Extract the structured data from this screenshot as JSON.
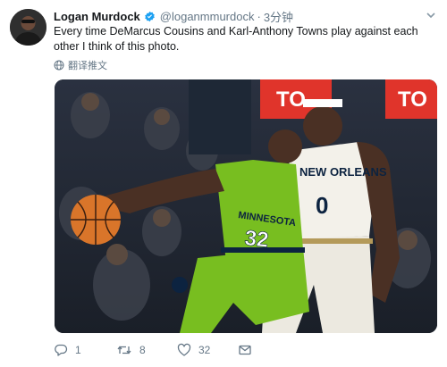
{
  "tweet": {
    "author_name": "Logan Murdock",
    "handle": "@loganmmurdock",
    "separator": "·",
    "time": "3分钟",
    "text": "Every time DeMarcus Cousins and Karl-Anthony Towns play against each other I think of this photo.",
    "translate_label": "翻译推文"
  },
  "photo": {
    "banner_left": "TO",
    "banner_right": "TO",
    "jersey_green_team": "MINNESOTA",
    "jersey_green_number": "32",
    "jersey_white_team": "NEW ORLEANS",
    "jersey_white_number": "0"
  },
  "actions": {
    "reply_count": "1",
    "retweet_count": "8",
    "like_count": "32"
  },
  "colors": {
    "verified": "#1da1f2",
    "icon_gray": "#657786",
    "green_jersey": "#78be20",
    "banner_red": "#e0342b"
  },
  "icons": {
    "verified": "verified-badge-icon",
    "translate": "globe-icon",
    "reply": "reply-icon",
    "retweet": "retweet-icon",
    "like": "heart-icon",
    "dm": "envelope-icon",
    "menu": "chevron-down-icon"
  }
}
